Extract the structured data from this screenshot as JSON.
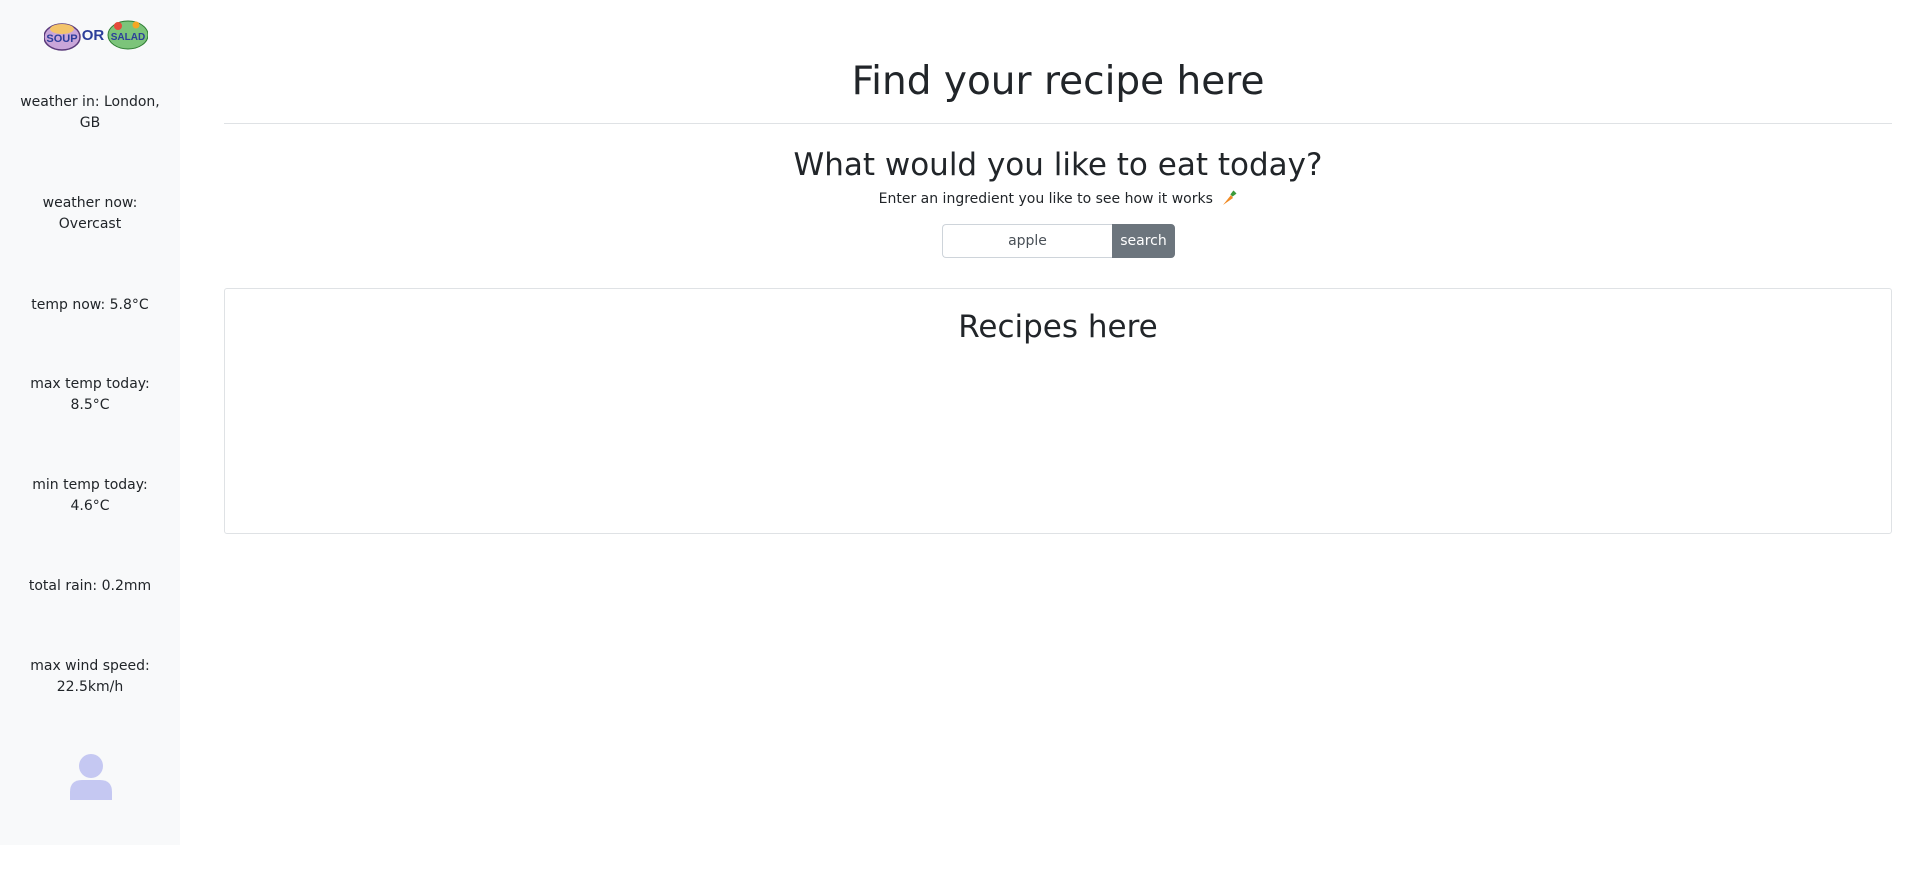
{
  "sidebar": {
    "logo": {
      "text_soup": "SOUP",
      "text_or": "OR",
      "text_salad": "SALAD"
    },
    "weather_location": "weather in: London, GB",
    "weather_now": "weather now: Overcast",
    "temp_now": "temp now: 5.8°C",
    "max_temp": "max temp today: 8.5°C",
    "min_temp": "min temp today: 4.6°C",
    "total_rain": "total rain: 0.2mm",
    "max_wind": "max wind speed: 22.5km/h",
    "avatar_icon": "user-icon"
  },
  "main": {
    "title": "Find your recipe here",
    "subtitle": "What would you like to eat today?",
    "hint": "Enter an ingredient you like to see how it works",
    "hint_icon": "carrot-icon",
    "search": {
      "value": "apple",
      "button_label": "search"
    },
    "recipes_title": "Recipes here"
  },
  "colors": {
    "sidebar_bg": "#f8f9fa",
    "button_bg": "#6c757d",
    "avatar": "#c5c8f2"
  }
}
